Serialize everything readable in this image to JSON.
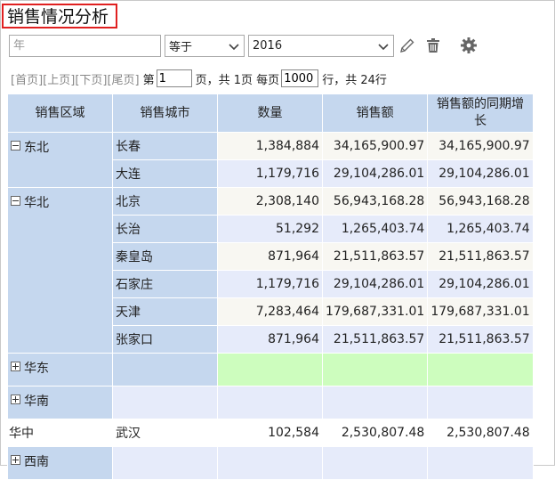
{
  "page": {
    "title": "销售情况分析"
  },
  "filter": {
    "field_placeholder": "年",
    "operator": "等于",
    "value": "2016"
  },
  "toolbar": {
    "icons": [
      "pencil-icon",
      "trash-icon",
      "gear-icon"
    ]
  },
  "pager": {
    "first": "[首页]",
    "prev": "[上页]",
    "next": "[下页]",
    "last": "[尾页]",
    "page_prefix": "第",
    "page_value": "1",
    "page_suffix": "页，共 1页 每页",
    "per_page_value": "1000",
    "rows_suffix": "行，共 24行"
  },
  "table": {
    "headers": [
      "销售区域",
      "销售城市",
      "数量",
      "销售额",
      "销售额的同期增长"
    ],
    "rows": [
      {
        "region": "东北",
        "region_toggle": "minus",
        "city": "长春",
        "qty": "1,384,884",
        "sales": "34,165,900.97",
        "yoy": "34,165,900.97"
      },
      {
        "region": "",
        "city": "大连",
        "qty": "1,179,716",
        "sales": "29,104,286.01",
        "yoy": "29,104,286.01"
      },
      {
        "region": "华北",
        "region_toggle": "minus",
        "city": "北京",
        "qty": "2,308,140",
        "sales": "56,943,168.28",
        "yoy": "56,943,168.28"
      },
      {
        "region": "",
        "city": "长治",
        "qty": "51,292",
        "sales": "1,265,403.74",
        "yoy": "1,265,403.74"
      },
      {
        "region": "",
        "city": "秦皇岛",
        "qty": "871,964",
        "sales": "21,511,863.57",
        "yoy": "21,511,863.57"
      },
      {
        "region": "",
        "city": "石家庄",
        "qty": "1,179,716",
        "sales": "29,104,286.01",
        "yoy": "29,104,286.01"
      },
      {
        "region": "",
        "city": "天津",
        "qty": "7,283,464",
        "sales": "179,687,331.01",
        "yoy": "179,687,331.01"
      },
      {
        "region": "",
        "city": "张家口",
        "qty": "871,964",
        "sales": "21,511,863.57",
        "yoy": "21,511,863.57"
      },
      {
        "region": "华东",
        "region_toggle": "plus",
        "city": "",
        "qty": "",
        "sales": "",
        "yoy": ""
      },
      {
        "region": "华南",
        "region_toggle": "plus",
        "city": "",
        "qty": "",
        "sales": "",
        "yoy": ""
      },
      {
        "region": "华中",
        "city": "武汉",
        "qty": "102,584",
        "sales": "2,530,807.48",
        "yoy": "2,530,807.48"
      },
      {
        "region": "西南",
        "region_toggle": "plus",
        "city": "",
        "qty": "",
        "sales": "",
        "yoy": ""
      }
    ]
  }
}
